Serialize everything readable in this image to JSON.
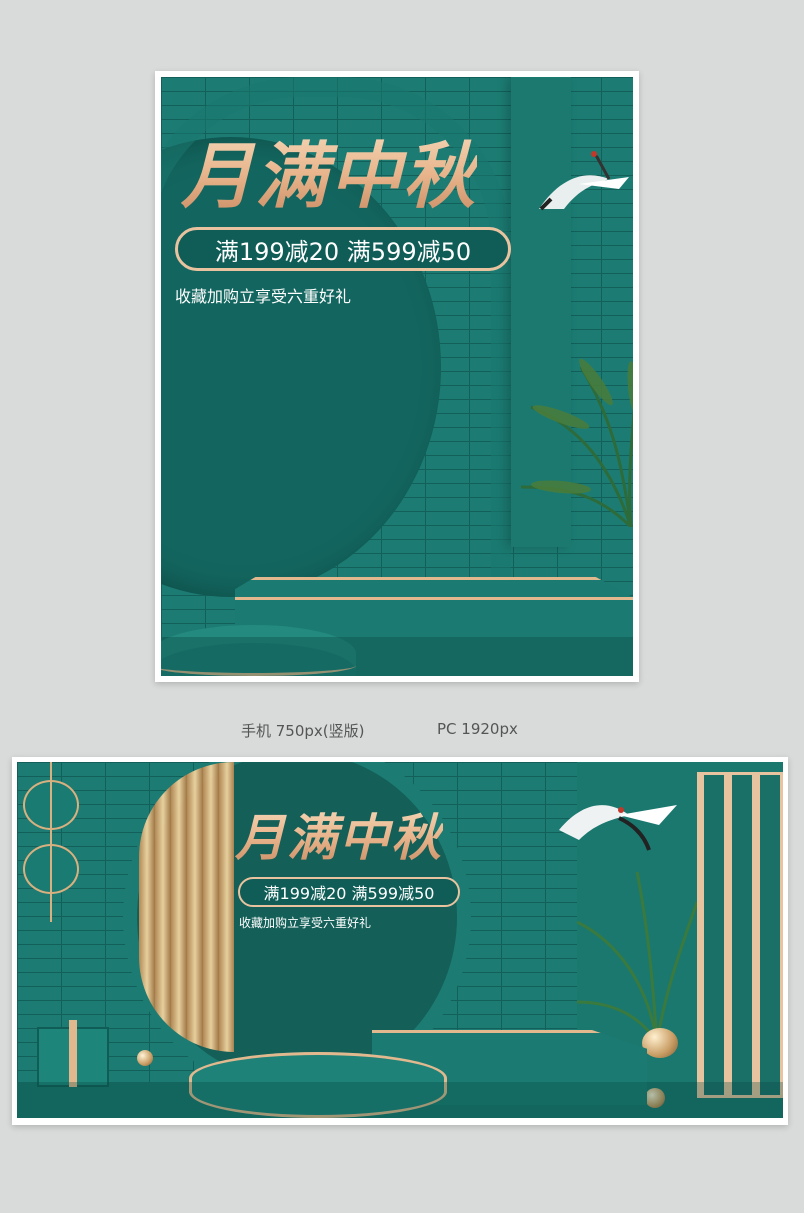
{
  "mobile_banner": {
    "title": "月满中秋",
    "promo": "满199减20 满599减50",
    "subtitle": "收藏加购立享受六重好礼"
  },
  "captions": {
    "mobile": "手机 750px(竖版)",
    "pc": "PC 1920px"
  },
  "pc_banner": {
    "title": "月满中秋",
    "promo": "满199减20 满599减50",
    "subtitle": "收藏加购立享受六重好礼"
  },
  "colors": {
    "background": "#d9dbdb",
    "teal": "#17746c",
    "teal_dark": "#0f5d56",
    "gold": "#e9c39f"
  }
}
